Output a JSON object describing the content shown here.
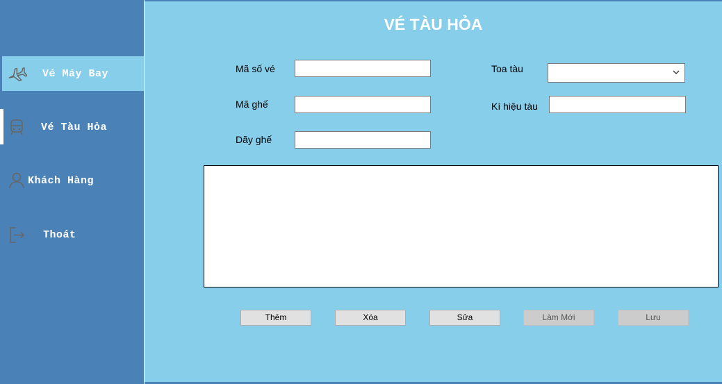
{
  "sidebar": {
    "items": [
      {
        "label": "Vé Máy Bay",
        "icon": "airplane-icon"
      },
      {
        "label": "Vé Tàu Hỏa",
        "icon": "train-icon"
      },
      {
        "label": "Khách Hàng",
        "icon": "user-icon"
      },
      {
        "label": "Thoát",
        "icon": "exit-icon"
      }
    ],
    "selected_index": 0,
    "current_index": 1
  },
  "main": {
    "title": "VÉ TÀU HỎA",
    "fields": {
      "ma_so_ve": {
        "label": "Mã số vé",
        "value": ""
      },
      "ma_ghe": {
        "label": "Mã ghế",
        "value": ""
      },
      "day_ghe": {
        "label": "Dãy ghế",
        "value": ""
      },
      "toa_tau": {
        "label": "Toa tàu",
        "value": ""
      },
      "ki_hieu_tau": {
        "label": "Kí hiệu tàu",
        "value": ""
      }
    },
    "buttons": {
      "them": "Thêm",
      "xoa": "Xóa",
      "sua": "Sửa",
      "lam_moi": "Làm Mới",
      "luu": "Lưu"
    }
  },
  "colors": {
    "sidebar_bg": "#4a82b8",
    "main_bg": "#87ceeb",
    "active_item_bg": "#87ceeb",
    "title_text": "#ffffff",
    "icon_stroke": "#666666"
  }
}
